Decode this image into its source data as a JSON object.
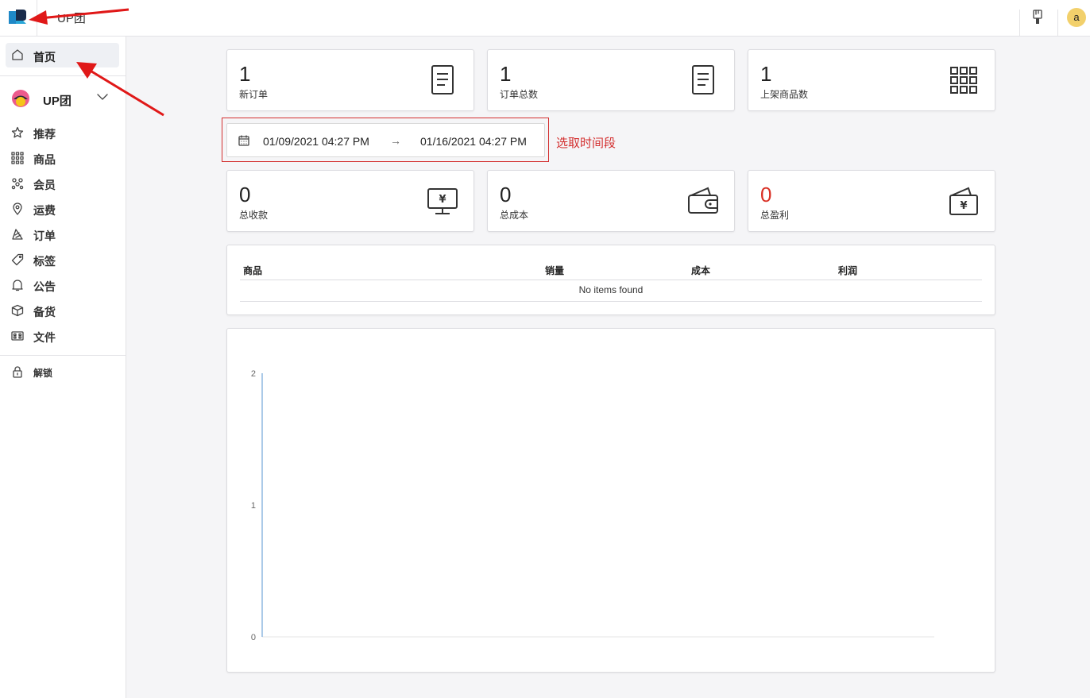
{
  "header": {
    "title": "UP团",
    "avatar_letter": "a",
    "icons": [
      "logo-icon",
      "brush-icon"
    ]
  },
  "sidebar": {
    "home_label": "首页",
    "store_name": "UP团",
    "items": [
      {
        "label": "推荐",
        "icon": "star-icon"
      },
      {
        "label": "商品",
        "icon": "grid-icon"
      },
      {
        "label": "会员",
        "icon": "members-icon"
      },
      {
        "label": "运费",
        "icon": "location-icon"
      },
      {
        "label": "订单",
        "icon": "order-icon"
      },
      {
        "label": "标签",
        "icon": "tag-icon"
      },
      {
        "label": "公告",
        "icon": "bell-icon"
      },
      {
        "label": "备货",
        "icon": "box-icon"
      },
      {
        "label": "文件",
        "icon": "file-icon"
      }
    ],
    "unlock_label": "解锁"
  },
  "stats_top": [
    {
      "value": "1",
      "caption": "新订单",
      "icon": "document-icon"
    },
    {
      "value": "1",
      "caption": "订单总数",
      "icon": "document-icon"
    },
    {
      "value": "1",
      "caption": "上架商品数",
      "icon": "grid-icon"
    }
  ],
  "date_range": {
    "start": "01/09/2021 04:27 PM",
    "arrow": "→",
    "end": "01/16/2021 04:27 PM",
    "note": "选取时间段"
  },
  "stats_bottom": [
    {
      "value": "0",
      "caption": "总收款",
      "icon": "monitor-yen-icon"
    },
    {
      "value": "0",
      "caption": "总成本",
      "icon": "wallet-icon"
    },
    {
      "value": "0",
      "caption": "总盈利",
      "icon": "wallet-yen-icon",
      "color": "#d93025"
    }
  ],
  "table": {
    "columns": [
      "商品",
      "销量",
      "成本",
      "利润"
    ],
    "empty_text": "No items found"
  },
  "chart_data": {
    "type": "line",
    "yticks": [
      "2",
      "1",
      "0"
    ],
    "ylim": [
      0,
      2
    ],
    "series": [],
    "axis_color": "#8fb8e0"
  },
  "colors": {
    "accent_red": "#d32f2f",
    "profit_red": "#d93025"
  }
}
